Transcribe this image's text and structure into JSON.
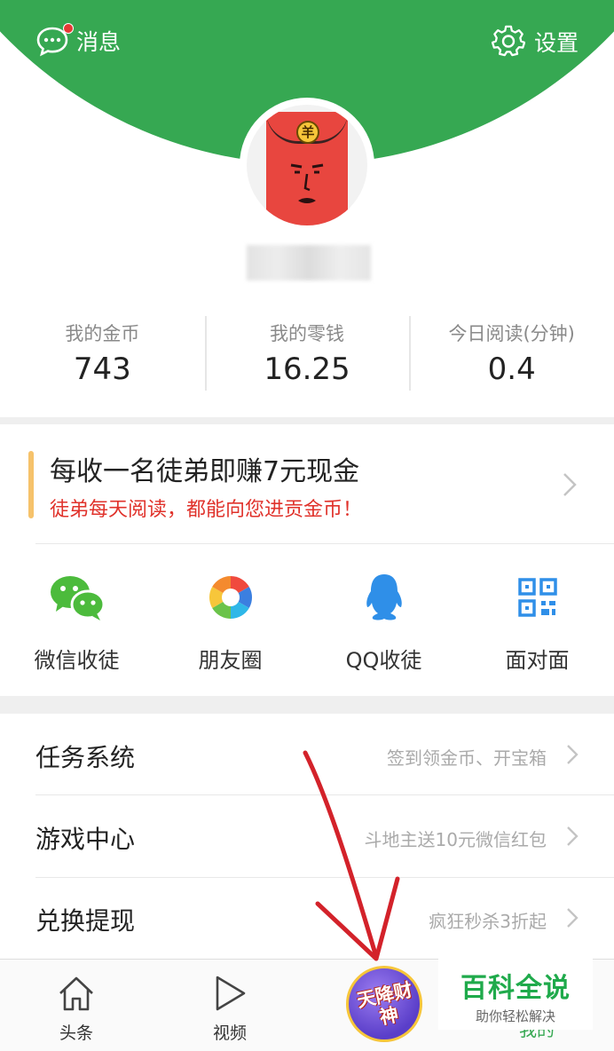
{
  "header": {
    "messages_label": "消息",
    "settings_label": "设置",
    "avatar_badge": "羊"
  },
  "stats": [
    {
      "label": "我的金币",
      "value": "743"
    },
    {
      "label": "我的零钱",
      "value": "16.25"
    },
    {
      "label": "今日阅读(分钟)",
      "value": "0.4"
    }
  ],
  "invite": {
    "title": "每收一名徒弟即赚7元现金",
    "subtitle": "徒弟每天阅读，都能向您进贡金币！",
    "accent_color": "#f6c26b",
    "subtitle_color": "#e0322b"
  },
  "share": [
    {
      "icon": "wechat-icon",
      "label": "微信收徒"
    },
    {
      "icon": "moments-icon",
      "label": "朋友圈"
    },
    {
      "icon": "qq-icon",
      "label": "QQ收徒"
    },
    {
      "icon": "qrcode-icon",
      "label": "面对面"
    }
  ],
  "menu": [
    {
      "title": "任务系统",
      "subtitle": "签到领金币、开宝箱"
    },
    {
      "title": "游戏中心",
      "subtitle": "斗地主送10元微信红包"
    },
    {
      "title": "兑换提现",
      "subtitle": "疯狂秒杀3折起"
    }
  ],
  "tabbar": {
    "tabs": [
      {
        "icon": "home-icon",
        "label": "头条"
      },
      {
        "icon": "play-icon",
        "label": "视频"
      }
    ],
    "promo_text": "天降财神",
    "mine_label": "我的"
  },
  "watermark": {
    "title": "百科全说",
    "subtitle": "助你轻松解决"
  },
  "colors": {
    "brand_green": "#36a852",
    "chevron": "#c4c4c4"
  }
}
